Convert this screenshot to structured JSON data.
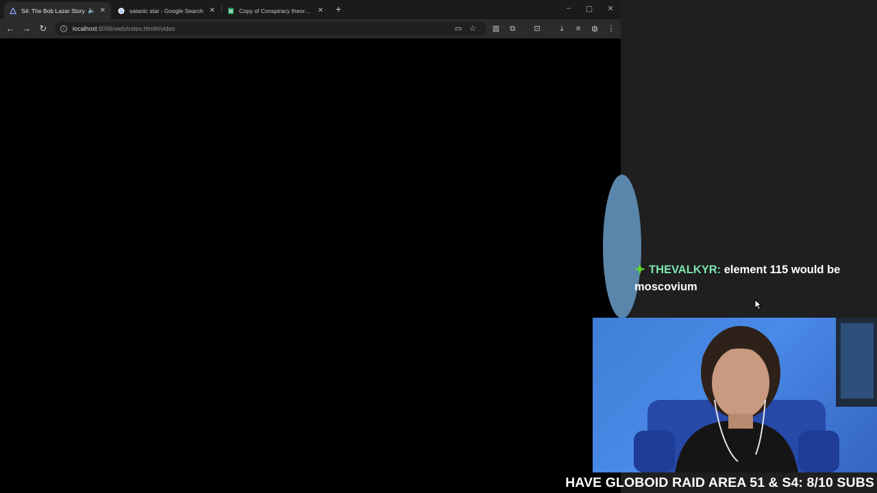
{
  "browser": {
    "tabs": [
      {
        "title": "S4: The Bob Lazar Story",
        "favicon": "jellyfin-icon",
        "active": true
      },
      {
        "title": "satanic star - Google Search",
        "favicon": "google-icon",
        "active": false
      },
      {
        "title": "Copy of Conspiracy theory / tre",
        "favicon": "sheets-icon",
        "active": false
      }
    ],
    "url_host": "localhost",
    "url_rest": ":8096/web/index.html#/video"
  },
  "chat": {
    "username": "THEVALKYR",
    "separator": ":",
    "message": " element 115 would be moscovium"
  },
  "ticker": {
    "text": "HAVE GLOBOID RAID AREA 51 & S4: 8/10 SUBS"
  },
  "colors": {
    "chat_username": "#7fe6b0",
    "blob": "#5b86ab",
    "webcam_bg": "#4a8ae8"
  }
}
